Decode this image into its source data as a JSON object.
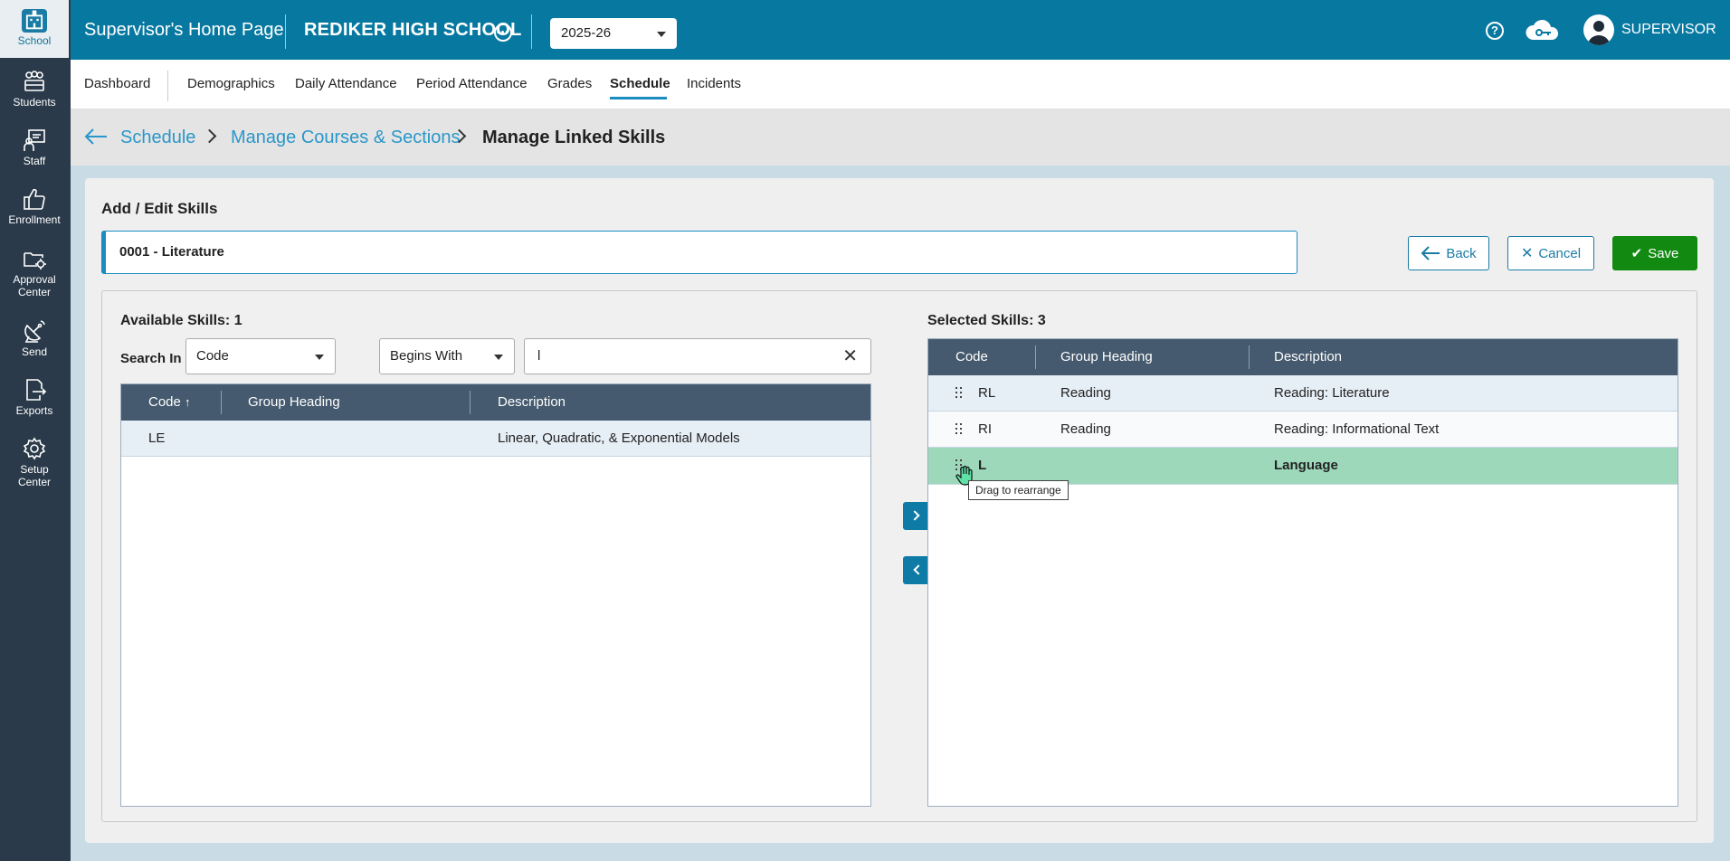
{
  "sidebar": {
    "items": [
      {
        "label": "School",
        "icon": "school-icon"
      },
      {
        "label": "Students",
        "icon": "students-icon"
      },
      {
        "label": "Staff",
        "icon": "staff-icon"
      },
      {
        "label": "Enrollment",
        "icon": "thumbs-up-icon"
      },
      {
        "label": "Approval",
        "label2": "Center",
        "icon": "folder-gear-icon"
      },
      {
        "label": "Send",
        "icon": "satellite-dish-icon"
      },
      {
        "label": "Exports",
        "icon": "file-export-icon"
      },
      {
        "label": "Setup",
        "label2": "Center",
        "icon": "gear-icon"
      }
    ]
  },
  "header": {
    "title": "Supervisor's Home Page",
    "school": "REDIKER HIGH SCHOOL",
    "year": "2025-26",
    "user": "SUPERVISOR",
    "help_glyph": "?"
  },
  "nav": {
    "items": [
      "Dashboard",
      "Demographics",
      "Daily Attendance",
      "Period Attendance",
      "Grades",
      "Schedule",
      "Incidents"
    ],
    "active": "Schedule"
  },
  "breadcrumb": {
    "items": [
      "Schedule",
      "Manage Courses & Sections",
      "Manage Linked Skills"
    ]
  },
  "panel": {
    "title": "Add / Edit Skills",
    "course": "0001 - Literature",
    "buttons": {
      "back": "Back",
      "cancel": "Cancel",
      "save": "Save"
    }
  },
  "available": {
    "label": "Available Skills: 1",
    "search_label": "Search In",
    "search_field": "Code",
    "search_mode": "Begins With",
    "search_value": "l",
    "columns": [
      "Code",
      "Group Heading",
      "Description"
    ],
    "sort_indicator": "↑",
    "rows": [
      {
        "code": "LE",
        "group": "",
        "description": "Linear, Quadratic, & Exponential Models"
      }
    ]
  },
  "selected": {
    "label": "Selected Skills: 3",
    "columns": [
      "Code",
      "Group Heading",
      "Description"
    ],
    "rows": [
      {
        "code": "RL",
        "group": "Reading",
        "description": "Reading: Literature"
      },
      {
        "code": "RI",
        "group": "Reading",
        "description": "Reading: Informational Text"
      },
      {
        "code": "L",
        "group": "",
        "description": "Language"
      }
    ]
  },
  "tooltip": "Drag to rearrange",
  "colors": {
    "header_bg": "#0779a1",
    "sidebar_bg": "#2a3a4a",
    "grid_header": "#455a6e",
    "save_green": "#128a12",
    "drag_row": "#9dd8bb",
    "link_blue": "#2a97c9"
  }
}
